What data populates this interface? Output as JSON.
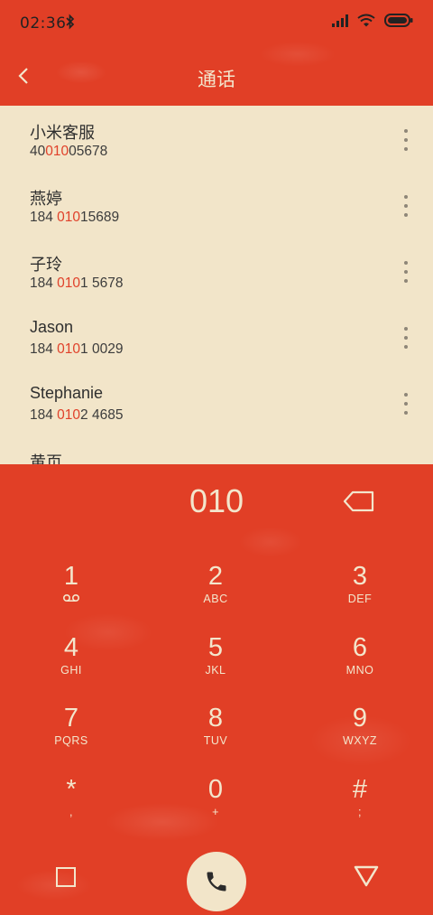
{
  "status": {
    "time": "02:36",
    "bluetooth_icon": "bluetooth-icon",
    "signal_icon": "signal-icon",
    "wifi_icon": "wifi-icon",
    "battery_icon": "battery-icon"
  },
  "header": {
    "title": "通话",
    "back_icon": "chevron-left-icon"
  },
  "results": [
    {
      "name": "小米客服",
      "number_parts": [
        "40",
        "010",
        "05678"
      ]
    },
    {
      "name": "燕婷",
      "number_parts": [
        "184 ",
        "010",
        "15689"
      ]
    },
    {
      "name": "子玲",
      "number_parts": [
        "184 ",
        "010",
        "1 5678"
      ]
    },
    {
      "name": "Jason",
      "number_parts": [
        "184 ",
        "010",
        "1 0029"
      ]
    },
    {
      "name": "Stephanie",
      "number_parts": [
        "184 ",
        "010",
        "2 4685"
      ]
    },
    {
      "name": "黄页",
      "number_parts": [
        "",
        "",
        ""
      ]
    }
  ],
  "dialer": {
    "input": "010",
    "delete_icon": "backspace-icon"
  },
  "keypad": [
    {
      "digit": "1",
      "letters": "voicemail"
    },
    {
      "digit": "2",
      "letters": "ABC"
    },
    {
      "digit": "3",
      "letters": "DEF"
    },
    {
      "digit": "4",
      "letters": "GHI"
    },
    {
      "digit": "5",
      "letters": "JKL"
    },
    {
      "digit": "6",
      "letters": "MNO"
    },
    {
      "digit": "7",
      "letters": "PQRS"
    },
    {
      "digit": "8",
      "letters": "TUV"
    },
    {
      "digit": "9",
      "letters": "WXYZ"
    },
    {
      "digit": "*",
      "letters": ","
    },
    {
      "digit": "0",
      "letters": "+"
    },
    {
      "digit": "#",
      "letters": ";"
    }
  ],
  "navbar": {
    "recents_icon": "square-icon",
    "call_icon": "phone-icon",
    "back_icon": "triangle-down-icon"
  },
  "colors": {
    "background": "#e13f26",
    "panel": "#f2e5c9",
    "highlight": "#e0412a",
    "text_light": "#f3e6cc"
  }
}
